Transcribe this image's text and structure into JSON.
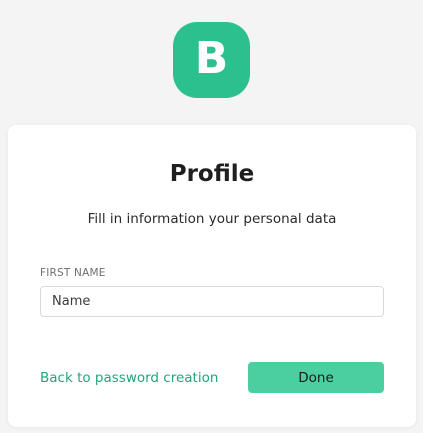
{
  "logo": {
    "letter": "B",
    "color": "#2cc08e"
  },
  "card": {
    "title": "Profile",
    "subtitle": "Fill in information your personal data",
    "first_name": {
      "label": "FIRST NAME",
      "placeholder": "Name",
      "value": ""
    },
    "back_link": "Back to password creation",
    "done_label": "Done"
  },
  "colors": {
    "accent": "#22a578",
    "button": "#4ccfa0",
    "background": "#f4f4f4"
  }
}
